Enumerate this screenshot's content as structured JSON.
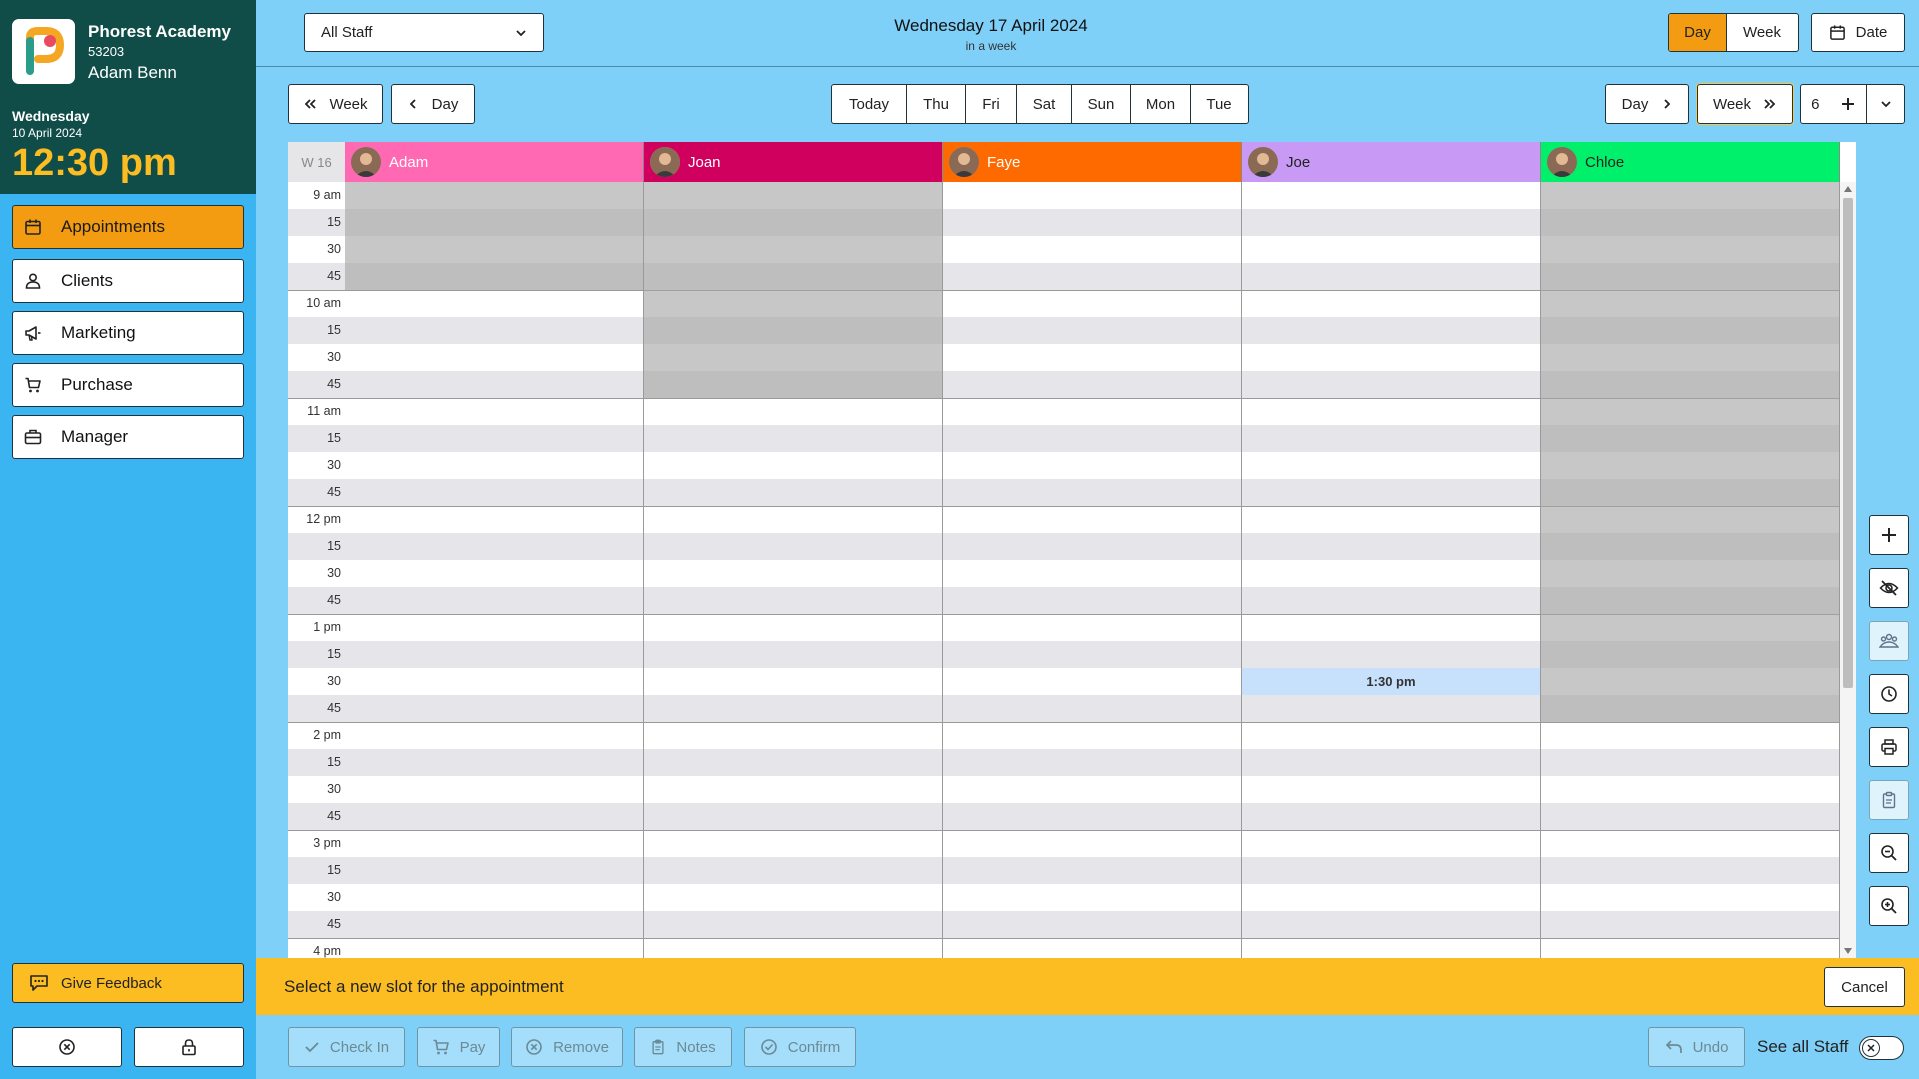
{
  "brand": {
    "org_name": "Phorest Academy",
    "org_code": "53203",
    "user_name": "Adam Benn"
  },
  "clock": {
    "weekday": "Wednesday",
    "date": "10 April 2024",
    "time": "12:30 pm"
  },
  "nav": [
    {
      "label": "Appointments",
      "icon": "calendar-icon",
      "active": true
    },
    {
      "label": "Clients",
      "icon": "users-icon"
    },
    {
      "label": "Marketing",
      "icon": "megaphone-icon"
    },
    {
      "label": "Purchase",
      "icon": "cart-icon"
    },
    {
      "label": "Manager",
      "icon": "briefcase-icon"
    }
  ],
  "feedback_label": "Give Feedback",
  "topbar": {
    "staff_select": "All Staff",
    "current_date": "Wednesday 17 April 2024",
    "relative": "in a week",
    "view_day": "Day",
    "view_week": "Week",
    "date_button": "Date"
  },
  "navrow": {
    "prev_week": "Week",
    "prev_day": "Day",
    "days": [
      "Today",
      "Thu",
      "Fri",
      "Sat",
      "Sun",
      "Mon",
      "Tue"
    ],
    "next_day": "Day",
    "next_week": "Week",
    "column_count": "6"
  },
  "calendar": {
    "week_label": "W 16",
    "staff": [
      {
        "name": "Adam",
        "color": "#ff69b4"
      },
      {
        "name": "Joan",
        "color": "#d0005f"
      },
      {
        "name": "Faye",
        "color": "#ff6a00"
      },
      {
        "name": "Joe",
        "color": "#c89af5"
      },
      {
        "name": "Chloe",
        "color": "#00f06c"
      }
    ],
    "time_labels": [
      "9 am",
      "15",
      "30",
      "45",
      "10 am",
      "15",
      "30",
      "45",
      "11 am",
      "15",
      "30",
      "45",
      "12 pm",
      "15",
      "30",
      "45",
      "1 pm",
      "15",
      "30",
      "45",
      "2 pm",
      "15",
      "30",
      "45",
      "3 pm",
      "15",
      "30",
      "45",
      "4 pm"
    ],
    "selected_slot": "1:30 pm"
  },
  "notice": {
    "message": "Select a new slot for the appointment",
    "cancel": "Cancel"
  },
  "actions": [
    "Check In",
    "Pay",
    "Remove",
    "Notes",
    "Confirm"
  ],
  "undo_label": "Undo",
  "see_all_staff": "See all Staff",
  "colors": {
    "accent": "#f39c12",
    "sidebar": "#3bb5f2",
    "brand_dark": "#114d48",
    "notice": "#fbbd22"
  }
}
